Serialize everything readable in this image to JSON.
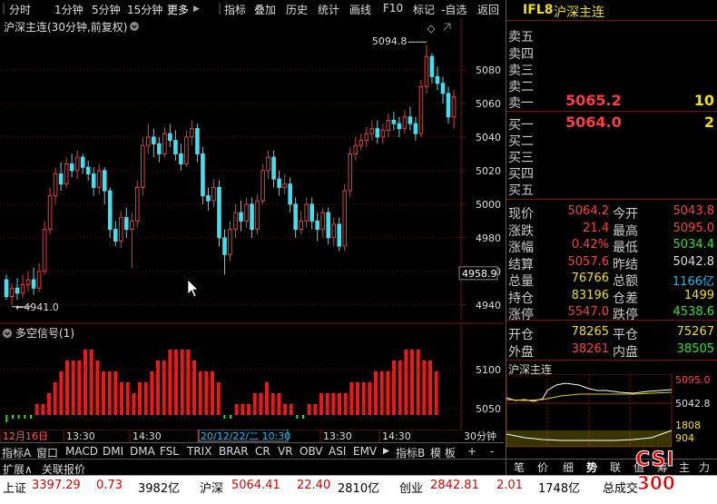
{
  "toolbar": {
    "periods": [
      "分时",
      "1分钟",
      "5分钟",
      "15分钟"
    ],
    "more": "更多",
    "more_arrow": "▶",
    "tools": [
      "指标",
      "叠加",
      "历史",
      "统计",
      "画线",
      "F10",
      "标记",
      "-自选",
      "返回"
    ]
  },
  "chart_title": "沪深主连(30分钟,前复权)",
  "indicator_title": "多空信号(1)",
  "chart_data": {
    "type": "candlestick",
    "y_ticks": [
      5080,
      5060,
      5040,
      5020,
      5000,
      4980,
      4960,
      4940
    ],
    "ylim": [
      4935,
      5100
    ],
    "high_label": "5094.8",
    "low_label": "4941.0",
    "cursor_price": "4958.9",
    "candles": [
      [
        4955,
        4945,
        4958,
        4943
      ],
      [
        4945,
        4950,
        4953,
        4940
      ],
      [
        4950,
        4947,
        4956,
        4943
      ],
      [
        4947,
        4952,
        4958,
        4944
      ],
      [
        4952,
        4955,
        4960,
        4948
      ],
      [
        4955,
        4950,
        4962,
        4946
      ],
      [
        4950,
        4960,
        4965,
        4948
      ],
      [
        4960,
        4985,
        4990,
        4958
      ],
      [
        4985,
        5005,
        5010,
        4982
      ],
      [
        5005,
        5018,
        5022,
        5000
      ],
      [
        5018,
        5012,
        5025,
        5008
      ],
      [
        5012,
        5024,
        5028,
        5010
      ],
      [
        5024,
        5020,
        5030,
        5016
      ],
      [
        5020,
        5028,
        5032,
        5015
      ],
      [
        5028,
        5022,
        5030,
        5018
      ],
      [
        5022,
        5018,
        5026,
        5014
      ],
      [
        5018,
        5010,
        5022,
        5005
      ],
      [
        5010,
        5020,
        5024,
        5006
      ],
      [
        5020,
        5008,
        5022,
        5000
      ],
      [
        5008,
        4985,
        5010,
        4980
      ],
      [
        4985,
        4978,
        4990,
        4975
      ],
      [
        4978,
        4992,
        4996,
        4974
      ],
      [
        4992,
        4985,
        4998,
        4980
      ],
      [
        4985,
        4990,
        4995,
        4962
      ],
      [
        4990,
        5010,
        5014,
        4986
      ],
      [
        5010,
        5035,
        5040,
        5005
      ],
      [
        5035,
        5040,
        5048,
        5030
      ],
      [
        5040,
        5036,
        5045,
        5028
      ],
      [
        5036,
        5030,
        5040,
        5025
      ],
      [
        5030,
        5042,
        5046,
        5028
      ],
      [
        5042,
        5038,
        5048,
        5034
      ],
      [
        5038,
        5030,
        5044,
        5026
      ],
      [
        5030,
        5024,
        5036,
        5020
      ],
      [
        5024,
        5040,
        5044,
        5022
      ],
      [
        5040,
        5045,
        5050,
        5035
      ],
      [
        5045,
        5030,
        5048,
        5025
      ],
      [
        5030,
        5005,
        5034,
        5000
      ],
      [
        5005,
        5002,
        5010,
        4996
      ],
      [
        5002,
        5010,
        5015,
        4998
      ],
      [
        5010,
        4980,
        5014,
        4975
      ],
      [
        4980,
        4970,
        4985,
        4958
      ],
      [
        4970,
        4985,
        4990,
        4966
      ],
      [
        4985,
        4995,
        5000,
        4980
      ],
      [
        4995,
        4990,
        5002,
        4984
      ],
      [
        4990,
        5000,
        5004,
        4986
      ],
      [
        5000,
        4985,
        5004,
        4980
      ],
      [
        4985,
        5002,
        5006,
        4982
      ],
      [
        5002,
        5020,
        5024,
        5000
      ],
      [
        5020,
        5028,
        5032,
        5015
      ],
      [
        5028,
        5015,
        5032,
        5010
      ],
      [
        5015,
        5010,
        5020,
        5005
      ],
      [
        5010,
        5012,
        5018,
        5006
      ],
      [
        5012,
        5000,
        5016,
        4995
      ],
      [
        5000,
        4985,
        5004,
        4980
      ],
      [
        4985,
        4990,
        4996,
        4982
      ],
      [
        4990,
        5000,
        5004,
        4986
      ],
      [
        5000,
        4990,
        5004,
        4985
      ],
      [
        4990,
        4985,
        4995,
        4978
      ],
      [
        4985,
        4995,
        4998,
        4980
      ],
      [
        4995,
        4980,
        4998,
        4976
      ],
      [
        4980,
        4988,
        4992,
        4975
      ],
      [
        4988,
        4975,
        4992,
        4972
      ],
      [
        4975,
        5008,
        5012,
        4972
      ],
      [
        5008,
        5030,
        5034,
        5004
      ],
      [
        5030,
        5035,
        5040,
        5026
      ],
      [
        5035,
        5038,
        5042,
        5032
      ],
      [
        5038,
        5042,
        5046,
        5034
      ],
      [
        5042,
        5045,
        5050,
        5038
      ],
      [
        5045,
        5040,
        5050,
        5036
      ],
      [
        5040,
        5044,
        5048,
        5036
      ],
      [
        5044,
        5050,
        5054,
        5040
      ],
      [
        5050,
        5048,
        5055,
        5044
      ],
      [
        5048,
        5045,
        5052,
        5040
      ],
      [
        5045,
        5052,
        5056,
        5042
      ],
      [
        5052,
        5048,
        5058,
        5044
      ],
      [
        5048,
        5042,
        5052,
        5038
      ],
      [
        5042,
        5070,
        5074,
        5040
      ],
      [
        5070,
        5088,
        5095,
        5066
      ],
      [
        5088,
        5076,
        5090,
        5072
      ],
      [
        5076,
        5072,
        5082,
        5068
      ],
      [
        5072,
        5066,
        5076,
        5060
      ],
      [
        5066,
        5052,
        5070,
        5048
      ],
      [
        5052,
        5064,
        5068,
        5045
      ]
    ],
    "signal_bars": [
      -2,
      -1,
      -1,
      -1,
      -1,
      1,
      1,
      2,
      3,
      4,
      5,
      5,
      5,
      6,
      6,
      5,
      4,
      4,
      4,
      3,
      3,
      2,
      3,
      3,
      4,
      5,
      5,
      6,
      6,
      6,
      6,
      5,
      4,
      4,
      4,
      3,
      -1,
      -1,
      1,
      1,
      1,
      2,
      2,
      3,
      2,
      2,
      1,
      1,
      -1,
      -1,
      1,
      1,
      2,
      2,
      2,
      2,
      2,
      3,
      3,
      3,
      3,
      4,
      4,
      4,
      5,
      5,
      6,
      6,
      6,
      5,
      5,
      4
    ],
    "ind_ticks": [
      5100,
      5050
    ],
    "x_labels": [
      "12月16日",
      "13:30",
      "14:30",
      "13:30",
      "14:30",
      "20/12/22/二 10:30",
      "13:30",
      "14:30"
    ],
    "period_label": "30分钟"
  },
  "bottom_tabs": [
    "指标A",
    "窗口",
    "MACD",
    "DMI",
    "DMA",
    "FSL",
    "TRIX",
    "BRAR",
    "CR",
    "VR",
    "OBV",
    "ASI",
    "EMV",
    "▶",
    "指标B",
    "模 板",
    "+",
    "-"
  ],
  "row2": [
    "扩展∧",
    "关联报价"
  ],
  "panel": {
    "code": "IFL8",
    "name": "沪深主连",
    "sells": [
      "卖五",
      "卖四",
      "卖三",
      "卖二",
      "卖一"
    ],
    "sell1_price": "5065.2",
    "sell1_vol": "10",
    "buys": [
      "买一",
      "买二",
      "买三",
      "买四",
      "买五"
    ],
    "buy1_price": "5064.0",
    "buy1_vol": "2",
    "quote_rows": [
      {
        "l1": "现价",
        "v1": "5064.2",
        "c1": "red",
        "l2": "今开",
        "v2": "5043.8",
        "c2": "red"
      },
      {
        "l1": "涨跌",
        "v1": "21.4",
        "c1": "red",
        "l2": "最高",
        "v2": "5095.0",
        "c2": "red"
      },
      {
        "l1": "涨幅",
        "v1": "0.42%",
        "c1": "red",
        "l2": "最低",
        "v2": "5034.4",
        "c2": "green"
      },
      {
        "l1": "结算",
        "v1": "5057.6",
        "c1": "red",
        "l2": "昨结",
        "v2": "5042.8",
        "c2": "white"
      },
      {
        "l1": "总量",
        "v1": "76766",
        "c1": "yellow",
        "l2": "总额",
        "v2": "1166亿",
        "c2": "cyan"
      },
      {
        "l1": "持仓",
        "v1": "83196",
        "c1": "yellow",
        "l2": "仓差",
        "v2": "1499",
        "c2": "yellow"
      },
      {
        "l1": "涨停",
        "v1": "5547.0",
        "c1": "red",
        "l2": "跌停",
        "v2": "4538.6",
        "c2": "green"
      }
    ],
    "open_close": [
      {
        "l1": "开仓",
        "v1": "78265",
        "c1": "yellow",
        "l2": "平仓",
        "v2": "75267",
        "c2": "yellow"
      },
      {
        "l1": "外盘",
        "v1": "38261",
        "c1": "red",
        "l2": "内盘",
        "v2": "38505",
        "c2": "green"
      }
    ],
    "mini_title": "沪深主连",
    "mini_top": "5095.0",
    "mini_mid": "5042.8",
    "mini_vol1": "1808",
    "mini_vol2": "904",
    "tabs": [
      "笔",
      "价",
      "细",
      "势",
      "联",
      "值",
      "筹",
      "主",
      "力"
    ]
  },
  "status": {
    "sh_label": "上证",
    "sh_val": "3397.29",
    "sh_chg": "0.73",
    "sh_amt": "3982亿",
    "hs_label": "沪深",
    "hs_val": "5064.41",
    "hs_chg": "22.40",
    "hs_amt": "2810亿",
    "cy_label": "创业",
    "cy_val": "2842.81",
    "cy_chg": "2.01",
    "cy_amt": "1748亿",
    "total_label": "总成交",
    "logo_csi": "CSI",
    "logo_300": "300"
  }
}
